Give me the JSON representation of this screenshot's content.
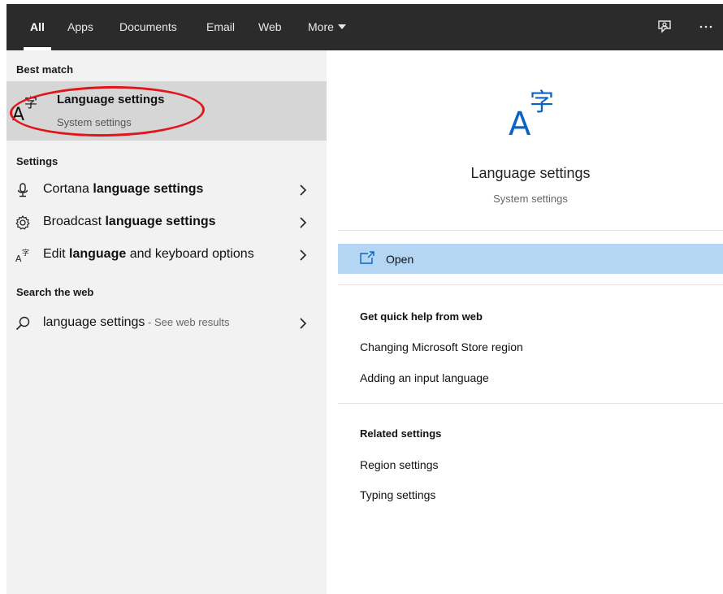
{
  "topbar": {
    "tabs": [
      {
        "label": "All",
        "active": true
      },
      {
        "label": "Apps",
        "active": false
      },
      {
        "label": "Documents",
        "active": false
      },
      {
        "label": "Email",
        "active": false
      },
      {
        "label": "Web",
        "active": false
      },
      {
        "label": "More",
        "active": false
      }
    ],
    "icons": [
      "feedback-icon",
      "more-options-icon"
    ]
  },
  "left": {
    "best_match_heading": "Best match",
    "best_match": {
      "icon": "language-icon",
      "title": "Language settings",
      "subtitle": "System settings",
      "annotation_color": "#e0161b"
    },
    "settings_heading": "Settings",
    "settings": [
      {
        "icon": "microphone-icon",
        "pre": "Cortana ",
        "bold": "language settings",
        "post": ""
      },
      {
        "icon": "gear-icon",
        "pre": "Broadcast ",
        "bold": "language settings",
        "post": ""
      },
      {
        "icon": "language-icon",
        "pre": "Edit ",
        "bold": "language",
        "post": " and keyboard options"
      }
    ],
    "web_heading": "Search the web",
    "web": {
      "icon": "search-icon",
      "query": "language settings",
      "hint": " - See web results"
    }
  },
  "right": {
    "icon": "language-icon",
    "title": "Language settings",
    "subtitle": "System settings",
    "open_label": "Open",
    "open_icon": "open-window-icon",
    "accent": "#b5d6f3",
    "quick_help_title": "Get quick help from web",
    "quick_help": [
      "Changing Microsoft Store region",
      "Adding an input language"
    ],
    "related_title": "Related settings",
    "related": [
      "Region settings",
      "Typing settings"
    ]
  }
}
